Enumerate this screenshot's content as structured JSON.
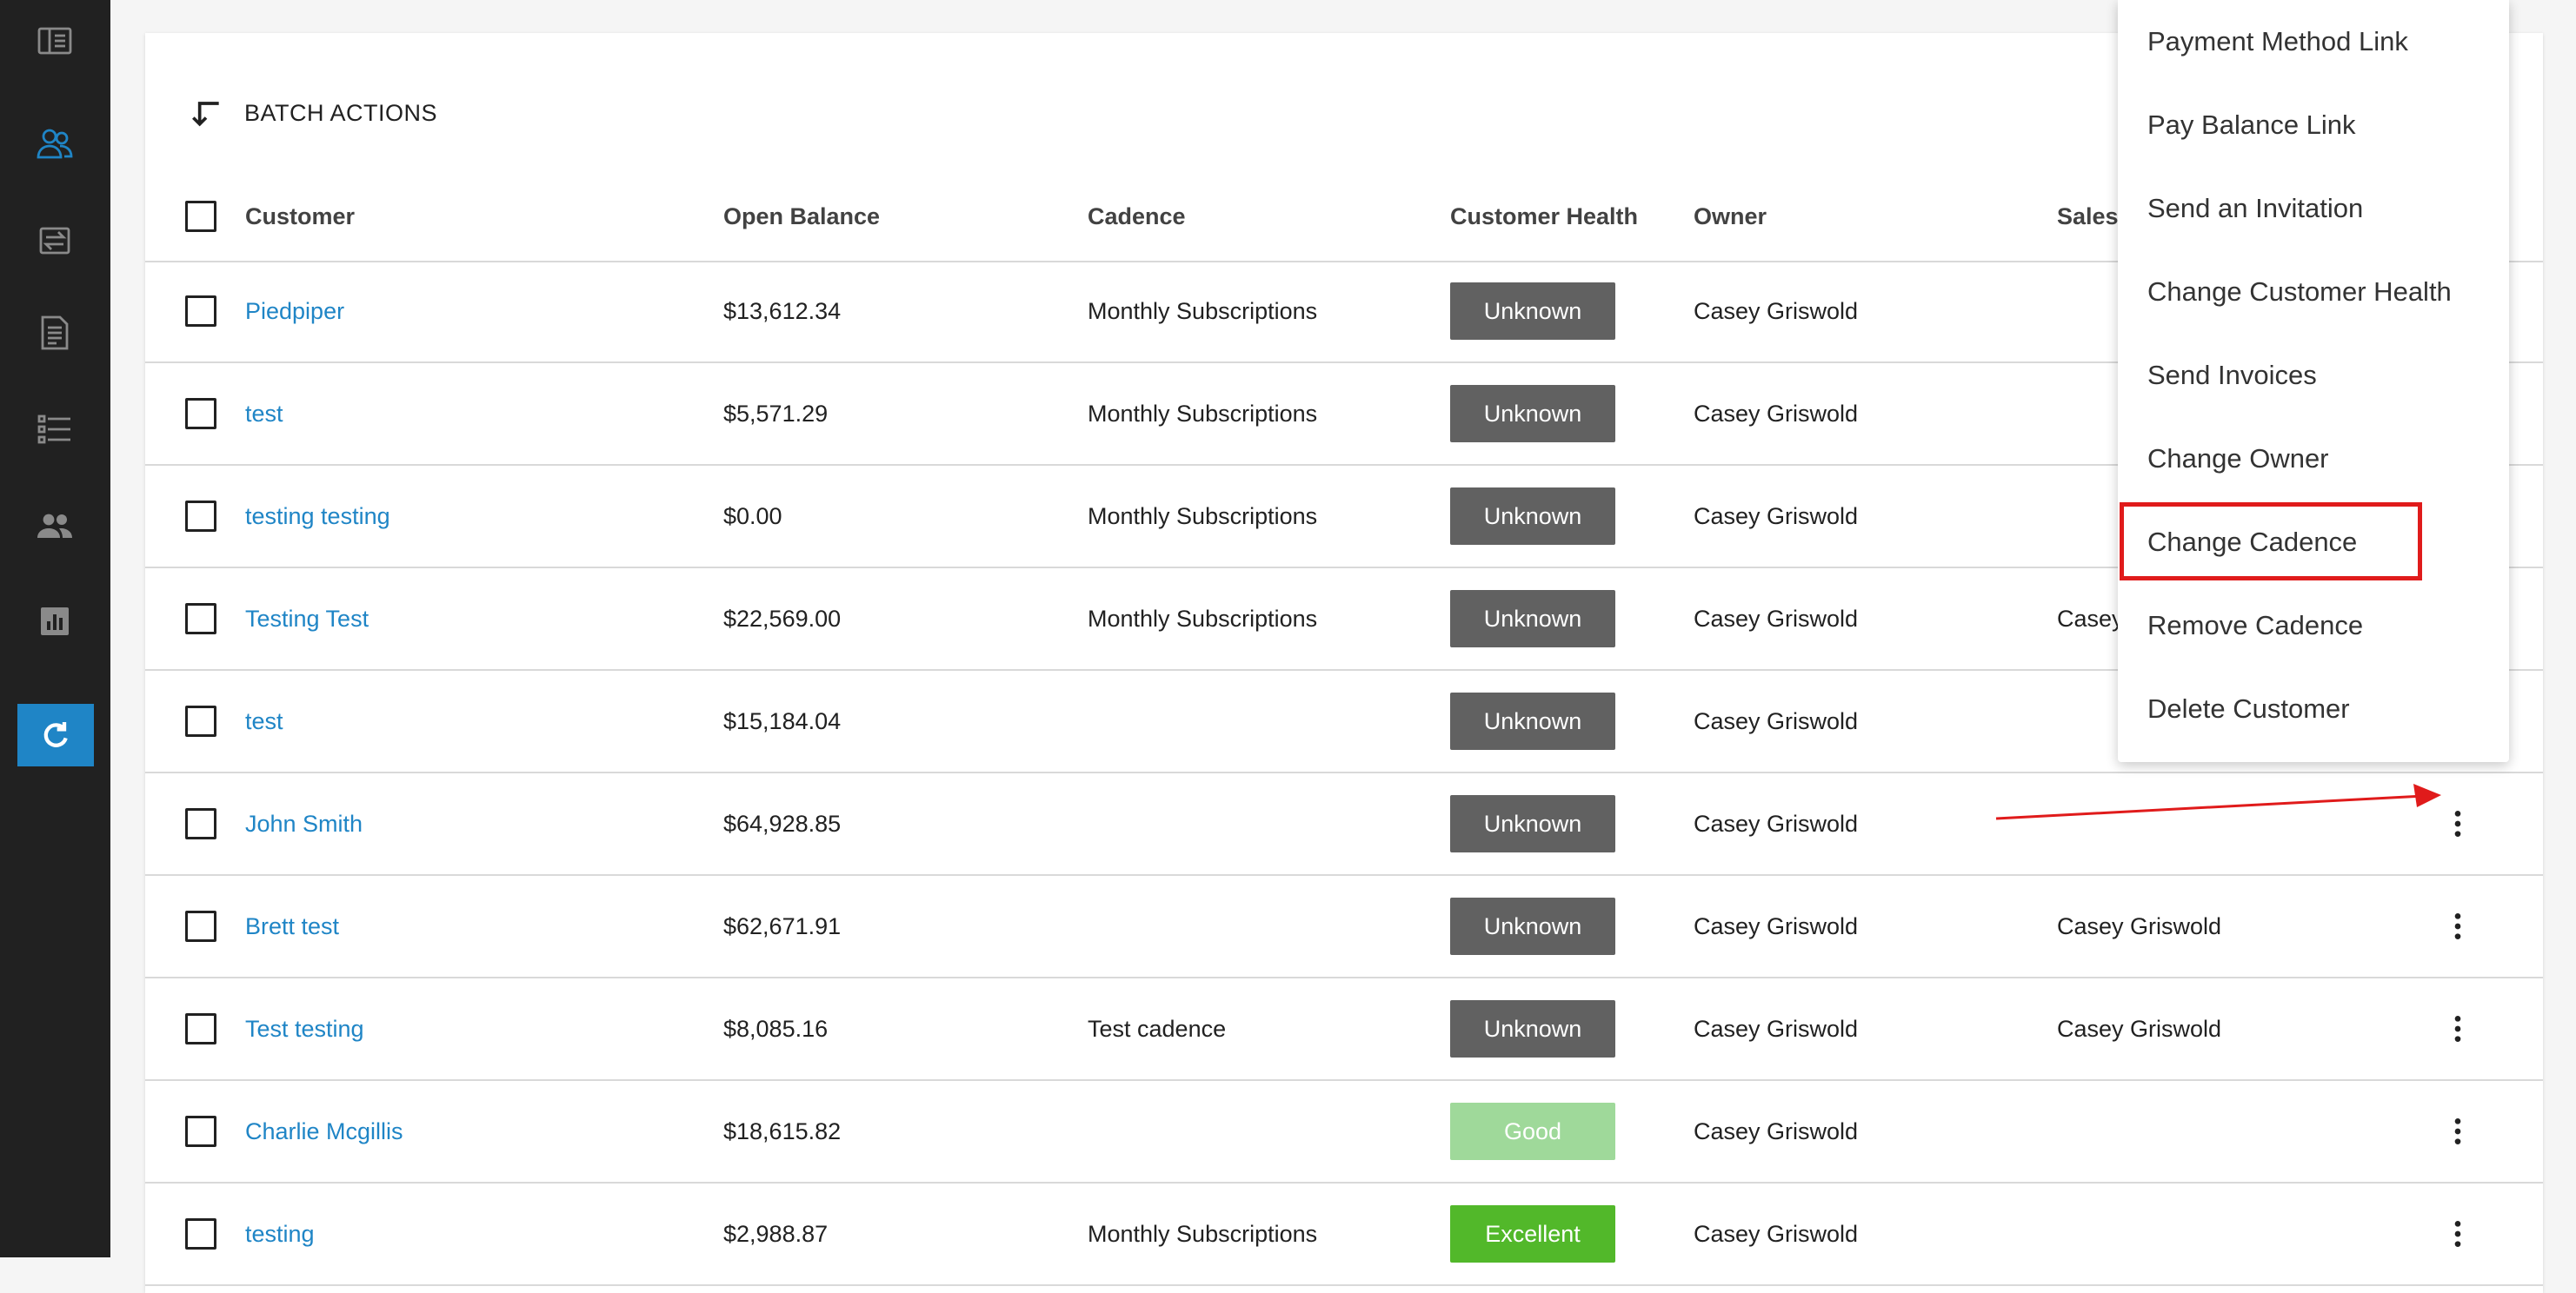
{
  "sidebar": {
    "icons": [
      "dashboard-icon",
      "customers-icon",
      "transfer-icon",
      "invoice-icon",
      "list-icon",
      "users-icon",
      "reports-icon",
      "refresh-icon"
    ],
    "active_color": "#1f85c6"
  },
  "toolbar": {
    "batch_actions_label": "BATCH ACTIONS"
  },
  "table": {
    "columns": {
      "customer": "Customer",
      "open_balance": "Open Balance",
      "cadence": "Cadence",
      "customer_health": "Customer Health",
      "owner": "Owner",
      "sales": "Sales"
    },
    "rows": [
      {
        "customer": "Piedpiper",
        "balance": "$13,612.34",
        "cadence": "Monthly Subscriptions",
        "health": "Unknown",
        "owner": "Casey Griswold",
        "sales": ""
      },
      {
        "customer": "test",
        "balance": "$5,571.29",
        "cadence": "Monthly Subscriptions",
        "health": "Unknown",
        "owner": "Casey Griswold",
        "sales": ""
      },
      {
        "customer": "testing testing",
        "balance": "$0.00",
        "cadence": "Monthly Subscriptions",
        "health": "Unknown",
        "owner": "Casey Griswold",
        "sales": ""
      },
      {
        "customer": "Testing Test",
        "balance": "$22,569.00",
        "cadence": "Monthly Subscriptions",
        "health": "Unknown",
        "owner": "Casey Griswold",
        "sales": "Casey"
      },
      {
        "customer": "test",
        "balance": "$15,184.04",
        "cadence": "",
        "health": "Unknown",
        "owner": "Casey Griswold",
        "sales": ""
      },
      {
        "customer": "John Smith",
        "balance": "$64,928.85",
        "cadence": "",
        "health": "Unknown",
        "owner": "Casey Griswold",
        "sales": ""
      },
      {
        "customer": "Brett test",
        "balance": "$62,671.91",
        "cadence": "",
        "health": "Unknown",
        "owner": "Casey Griswold",
        "sales": "Casey Griswold"
      },
      {
        "customer": "Test testing",
        "balance": "$8,085.16",
        "cadence": "Test cadence",
        "health": "Unknown",
        "owner": "Casey Griswold",
        "sales": "Casey Griswold"
      },
      {
        "customer": "Charlie Mcgillis",
        "balance": "$18,615.82",
        "cadence": "",
        "health": "Good",
        "owner": "Casey Griswold",
        "sales": ""
      },
      {
        "customer": "testing",
        "balance": "$2,988.87",
        "cadence": "Monthly Subscriptions",
        "health": "Excellent",
        "owner": "Casey Griswold",
        "sales": ""
      }
    ]
  },
  "health_colors": {
    "Unknown": "#616161",
    "Good": "#9fd99a",
    "Excellent": "#52b82a"
  },
  "menu": {
    "items": [
      "Payment Method Link",
      "Pay Balance Link",
      "Send an Invitation",
      "Change Customer Health",
      "Send Invoices",
      "Change Owner",
      "Change Cadence",
      "Remove Cadence",
      "Delete Customer"
    ],
    "highlighted": "Change Cadence"
  },
  "annotation_color": "#e01b1b"
}
